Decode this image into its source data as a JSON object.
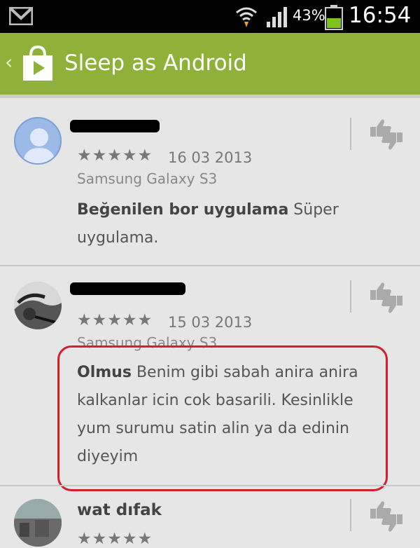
{
  "status_bar": {
    "battery_percent": "43%",
    "time": "16:54"
  },
  "action_bar": {
    "title": "Sleep as Android",
    "icons": [
      "back-chevron-icon",
      "play-store-bag-icon"
    ]
  },
  "reviews": [
    {
      "rating_stars": "★★★★★",
      "rating": 5,
      "date": "16 03 2013",
      "device": "Samsung Galaxy S3",
      "review_title": "Beğenilen bor uygulama",
      "review_body": "Süper uygulama.",
      "author_redacted": true
    },
    {
      "rating_stars": "★★★★★",
      "rating": 5,
      "date": "15 03 2013",
      "device": "Samsung Galaxy S3",
      "review_title": "Olmus",
      "review_body": "Benim gibi sabah anira anira kalkanlar icin cok basarili. Kesinlikle yum surumu satin alin ya da edinin diyeyim",
      "author_redacted": true,
      "highlighted": true,
      "highlight_color": "#d4202e"
    },
    {
      "author": "wat dıfak",
      "rating_stars": "★★★★★"
    }
  ],
  "colors": {
    "action_bar": "#8fb13a",
    "status_bar": "#000000",
    "background": "#e6e6e6"
  }
}
